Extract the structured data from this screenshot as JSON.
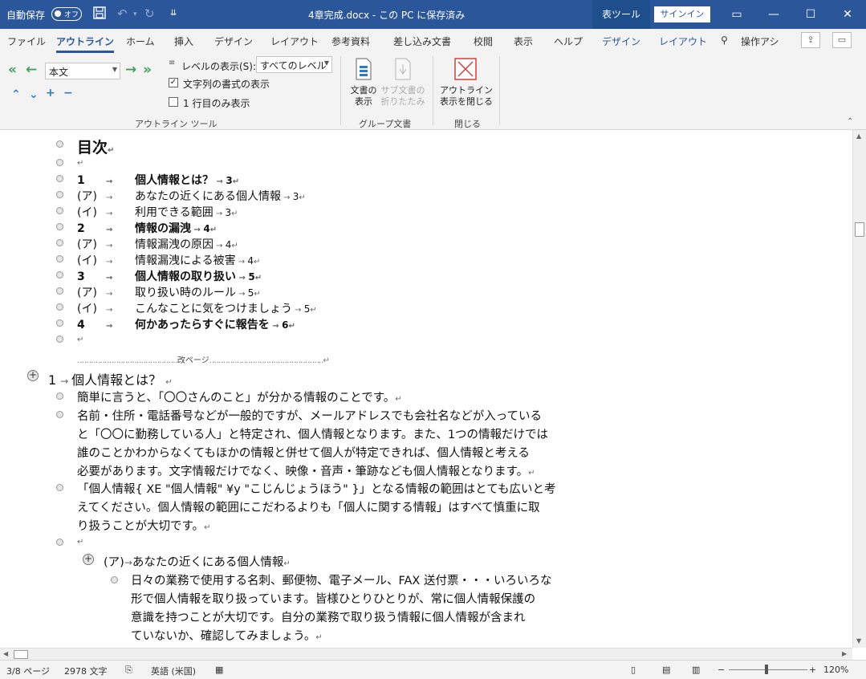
{
  "titlebar": {
    "autosave_label": "自動保存",
    "autosave_state": "オフ",
    "doc_title": "4章完成.docx - この PC に保存済み",
    "context_tab": "表ツール",
    "signin": "サインイン"
  },
  "tabs": [
    "ファイル",
    "アウトライン",
    "ホーム",
    "挿入",
    "デザイン",
    "レイアウト",
    "参考資料",
    "差し込み文書",
    "校閲",
    "表示",
    "ヘルプ",
    "デザイン",
    "レイアウト"
  ],
  "tell_me": "操作アシ",
  "ribbon": {
    "style_value": "本文",
    "level_label": "レベルの表示(S):",
    "level_value": "すべてのレベル",
    "show_format": "文字列の書式の表示",
    "first_line_only": "1 行目のみ表示",
    "group_outline": "アウトライン ツール",
    "show_doc_1": "文書の",
    "show_doc_2": "表示",
    "subdoc_1": "サブ文書の",
    "subdoc_2": "折りたたみ",
    "group_master": "グループ文書",
    "close_1": "アウトライン",
    "close_2": "表示を閉じる",
    "group_close": "閉じる"
  },
  "document": {
    "toc_title": "目次",
    "toc": [
      {
        "num": "1",
        "text": "個人情報とは？",
        "page": "3",
        "bold": true
      },
      {
        "num": "(ア)",
        "text": "あなたの近くにある個人情報",
        "page": "3",
        "bold": false
      },
      {
        "num": "(イ)",
        "text": "利用できる範囲",
        "page": "3",
        "bold": false
      },
      {
        "num": "2",
        "text": "情報の漏洩",
        "page": "4",
        "bold": true
      },
      {
        "num": "(ア)",
        "text": "情報漏洩の原因",
        "page": "4",
        "bold": false
      },
      {
        "num": "(イ)",
        "text": "情報漏洩による被害",
        "page": "4",
        "bold": false
      },
      {
        "num": "3",
        "text": "個人情報の取り扱い",
        "page": "5",
        "bold": true
      },
      {
        "num": "(ア)",
        "text": "取り扱い時のルール",
        "page": "5",
        "bold": false
      },
      {
        "num": "(イ)",
        "text": "こんなことに気をつけましょう",
        "page": "5",
        "bold": false
      },
      {
        "num": "4",
        "text": "何かあったらすぐに報告を",
        "page": "6",
        "bold": true
      }
    ],
    "page_break": "改ページ",
    "heading1_num": "1",
    "heading1_text": "個人情報とは？",
    "p1": "簡単に言うと、「〇〇さんのこと」が分かる情報のことです。",
    "p2_lines": [
      "名前・住所・電話番号などが一般的ですが、メールアドレスでも会社名などが入っている",
      "と「〇〇に勤務している人」と特定され、個人情報となります。また、1つの情報だけでは",
      "誰のことかわからなくてもほかの情報と併せて個人が特定できれば、個人情報と考える",
      "必要があります。文字情報だけでなく、映像・音声・筆跡なども個人情報となります。"
    ],
    "p3_lines": [
      "「個人情報{ XE \"個人情報\" ¥y \"こじんじょうほう\" }」となる情報の範囲はとても広いと考",
      "えてください。個人情報の範囲にこだわるよりも「個人に関する情報」はすべて慎重に取",
      "り扱うことが大切です。"
    ],
    "heading2_num": "(ア)",
    "heading2_text": "あなたの近くにある個人情報",
    "p4_lines": [
      "日々の業務で使用する名刺、郵便物、電子メール、FAX 送付票・・・いろいろな",
      "形で個人情報を取り扱っています。皆様ひとりひとりが、常に個人情報保護の",
      "意識を持つことが大切です。自分の業務で取り扱う情報に個人情報が含まれ",
      "ていないか、確認してみましょう。"
    ]
  },
  "status": {
    "page": "3/8 ページ",
    "words": "2978 文字",
    "lang": "英語 (米国)",
    "zoom": "120%"
  }
}
